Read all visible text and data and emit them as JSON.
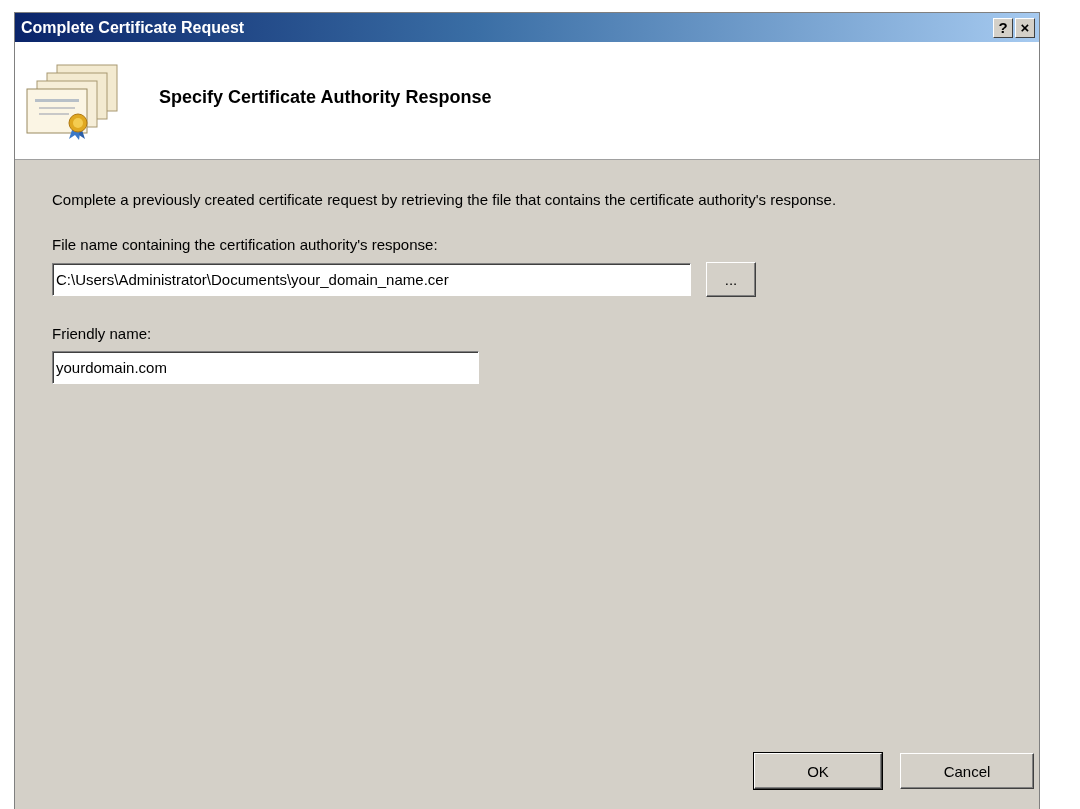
{
  "window": {
    "title": "Complete Certificate Request",
    "title_buttons": [
      "?",
      "×"
    ]
  },
  "header": {
    "title": "Specify Certificate Authority Response"
  },
  "description": "Complete a previously created certificate request by retrieving the file that contains the certificate authority's response.",
  "fields": [
    {
      "label": "File name containing the certification authority's response:",
      "value": "C:\\Users\\Administrator\\Documents\\your_domain_name.cer",
      "browse": "..."
    },
    {
      "label": "Friendly name:",
      "value": "yourdomain.com"
    }
  ],
  "buttons": [
    {
      "label": "OK",
      "default": true
    },
    {
      "label": "Cancel",
      "default": false
    }
  ]
}
